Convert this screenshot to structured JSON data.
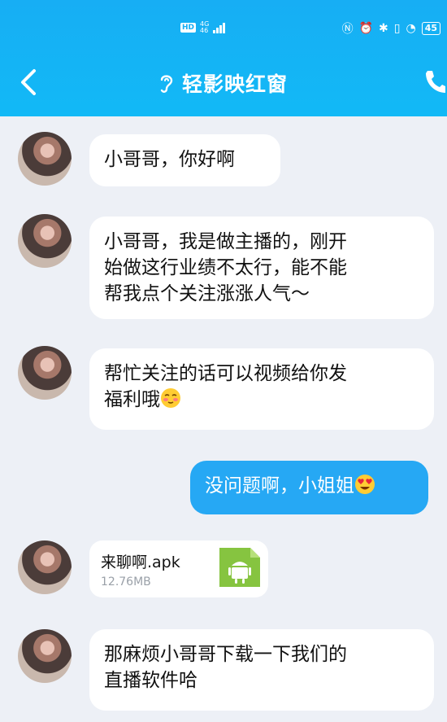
{
  "status_bar": {
    "hd": "HD",
    "net_top": "4G",
    "net_bottom": "46",
    "battery": "45"
  },
  "header": {
    "title": "轻影映红窗",
    "colors": {
      "accent": "#17aef4",
      "outgoing_bubble": "#26a8f4",
      "background": "#edf0f6"
    }
  },
  "messages": [
    {
      "side": "in",
      "text": "小哥哥，你好啊"
    },
    {
      "side": "in",
      "lines": [
        "小哥哥，我是做主播的，刚开",
        "始做这行业绩不太行，能不能",
        "帮我点个关注涨涨人气～"
      ]
    },
    {
      "side": "in",
      "lines": [
        "帮忙关注的话可以视频给你发",
        "福利哦"
      ],
      "emoji": "blushing-face-icon"
    },
    {
      "side": "out",
      "text": "没问题啊，小姐姐",
      "emoji": "heart-eyes-face-icon"
    },
    {
      "side": "in",
      "file": {
        "name": "来聊啊.apk",
        "size": "12.76MB",
        "icon": "android-apk-icon"
      }
    },
    {
      "side": "in",
      "lines": [
        "那麻烦小哥哥下载一下我们的",
        "直播软件哈"
      ]
    }
  ]
}
